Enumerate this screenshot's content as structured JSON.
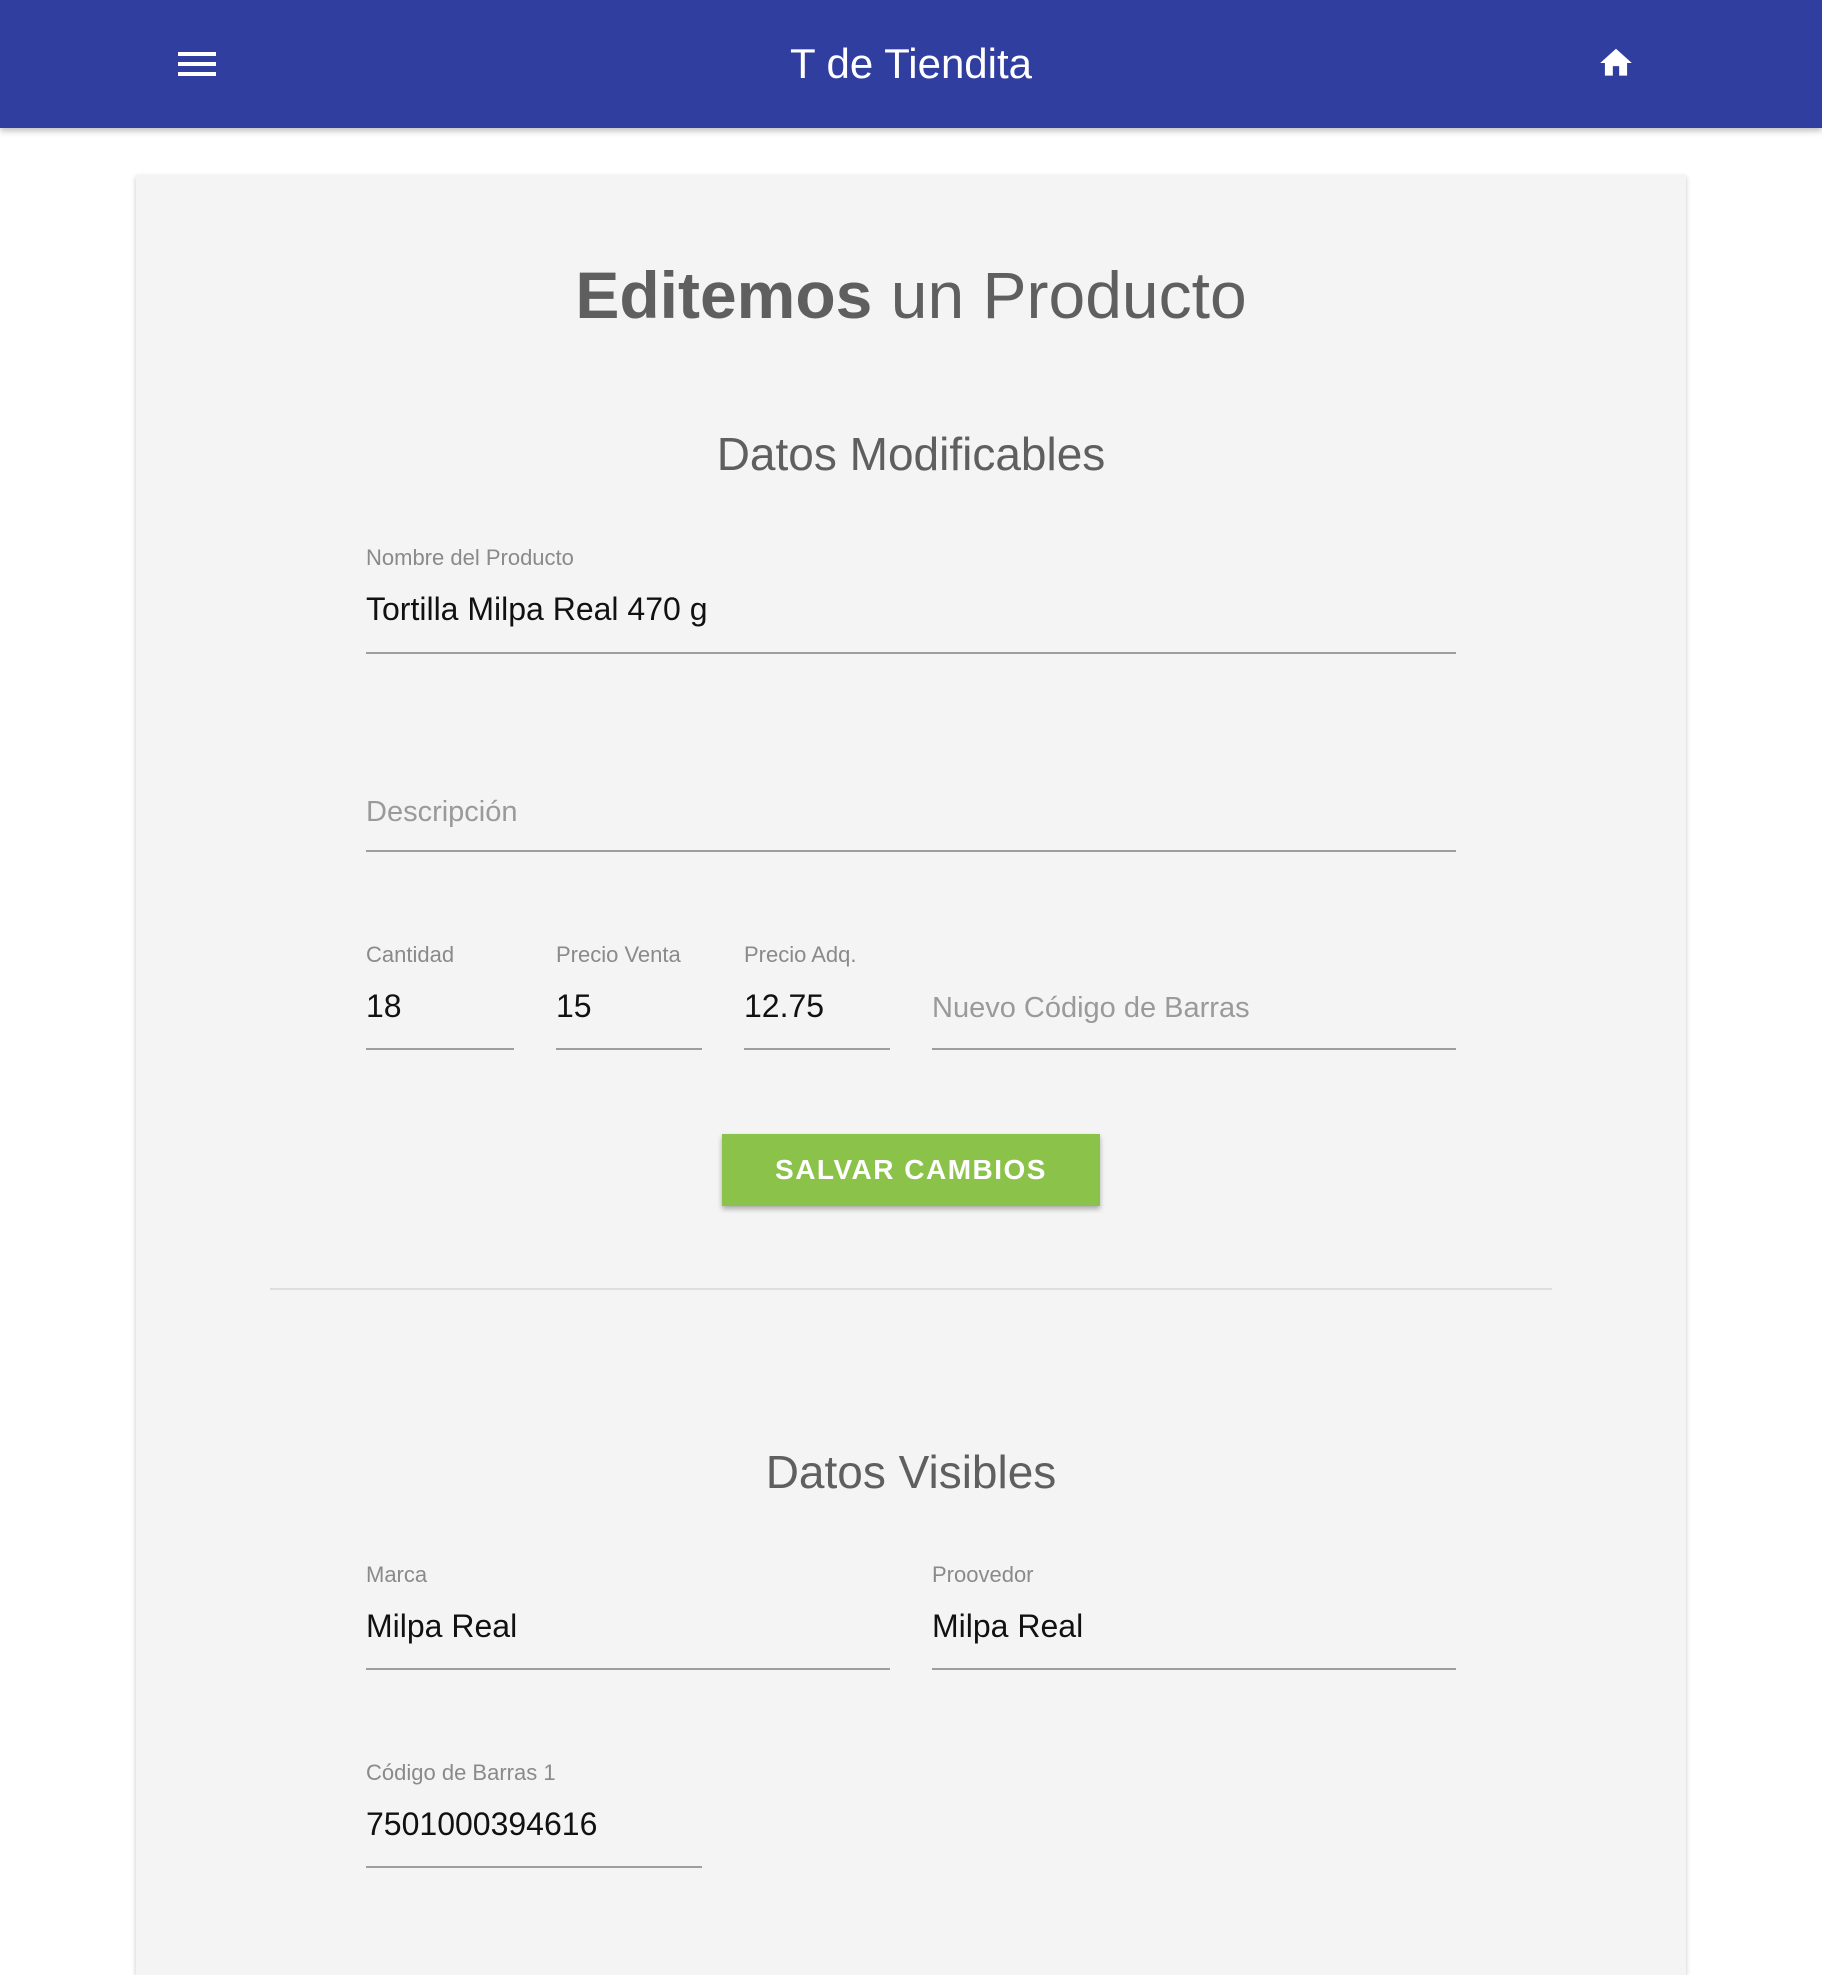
{
  "header": {
    "title": "T de Tiendita",
    "menu_icon": "menu-icon",
    "home_icon": "home-icon",
    "background": "#303f9f"
  },
  "page": {
    "title_bold": "Editemos",
    "title_rest": " un Producto"
  },
  "editable": {
    "section_title": "Datos Modificables",
    "product_name": {
      "label": "Nombre del Producto",
      "value": "Tortilla Milpa Real 470 g"
    },
    "description": {
      "placeholder": "Descripción"
    },
    "quantity": {
      "label": "Cantidad",
      "value": "18"
    },
    "sale_price": {
      "label": "Precio Venta",
      "value": "15"
    },
    "purchase_price": {
      "label": "Precio Adq.",
      "value": "12.75"
    },
    "new_barcode": {
      "placeholder": "Nuevo Código de Barras"
    },
    "save_label": "SALVAR CAMBIOS",
    "save_color": "#8bc34a"
  },
  "visible": {
    "section_title": "Datos Visibles",
    "brand": {
      "label": "Marca",
      "value": "Milpa Real"
    },
    "supplier": {
      "label": "Proovedor",
      "value": "Milpa Real"
    },
    "barcode1": {
      "label": "Código de Barras 1",
      "value": "7501000394616"
    }
  }
}
